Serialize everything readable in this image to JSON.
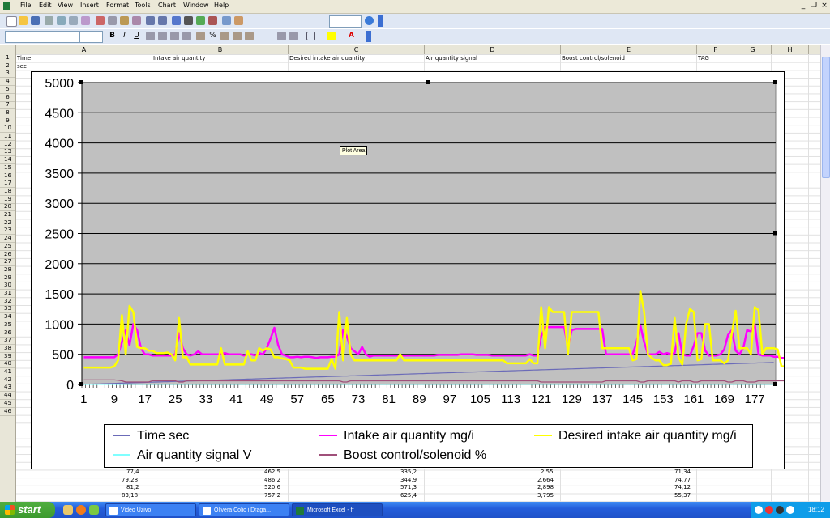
{
  "menu": {
    "items": [
      "File",
      "Edit",
      "View",
      "Insert",
      "Format",
      "Tools",
      "Chart",
      "Window",
      "Help"
    ]
  },
  "columns": [
    "A",
    "B",
    "C",
    "D",
    "E",
    "F",
    "G",
    "H"
  ],
  "rows": [
    "1",
    "2",
    "3",
    "4",
    "5",
    "6",
    "7",
    "8",
    "9",
    "10",
    "11",
    "12",
    "13",
    "14",
    "15",
    "16",
    "17",
    "18",
    "19",
    "20",
    "21",
    "22",
    "23",
    "24",
    "25",
    "26",
    "27",
    "28",
    "29",
    "30",
    "31",
    "32",
    "33",
    "34",
    "35",
    "36",
    "37",
    "38",
    "39",
    "40",
    "41",
    "42",
    "43",
    "44",
    "45",
    "46"
  ],
  "sheet": {
    "header_row": [
      "Time",
      "Intake air quantity",
      "Desired intake air quantity",
      "Air quantity signal",
      "Boost control/solenoid",
      "TAG"
    ],
    "row2_a": "sec",
    "bottom_rows": [
      [
        "77,4",
        "462,5",
        "335,2",
        "2,55",
        "71,34"
      ],
      [
        "79,28",
        "486,2",
        "344,9",
        "2,664",
        "74,77"
      ],
      [
        "81,2",
        "520,6",
        "571,3",
        "2,898",
        "74,12"
      ],
      [
        "83,18",
        "757,2",
        "625,4",
        "3,795",
        "55,37"
      ]
    ]
  },
  "chart_data": {
    "type": "line",
    "title": "",
    "xlabel": "",
    "ylabel": "",
    "ylim": [
      0,
      5000
    ],
    "yticks": [
      0,
      500,
      1000,
      1500,
      2000,
      2500,
      3000,
      3500,
      4000,
      4500,
      5000
    ],
    "x_tick_labels": [
      "1",
      "9",
      "17",
      "25",
      "33",
      "41",
      "49",
      "57",
      "65",
      "73",
      "81",
      "89",
      "97",
      "105",
      "113",
      "121",
      "129",
      "137",
      "145",
      "153",
      "161",
      "169",
      "177"
    ],
    "x_count": 182,
    "plot_background": "#c0c0c0",
    "gridlines": true,
    "legend_position": "bottom",
    "series": [
      {
        "name": "Time sec",
        "color": "#6b6bb8",
        "values": [
          2,
          4,
          6,
          8,
          10,
          12,
          14,
          16,
          18,
          20,
          22,
          24,
          26,
          28,
          30,
          32,
          34,
          36,
          38,
          40,
          42,
          44,
          46,
          48,
          50,
          52,
          54,
          56,
          58,
          60,
          62,
          64,
          66,
          68,
          70,
          72,
          74,
          76,
          78,
          80,
          82,
          84,
          86,
          88,
          90,
          92,
          94,
          96,
          98,
          100,
          102,
          104,
          106,
          108,
          110,
          112,
          114,
          116,
          118,
          120,
          122,
          124,
          126,
          128,
          130,
          132,
          134,
          136,
          138,
          140,
          142,
          144,
          146,
          148,
          150,
          152,
          154,
          156,
          158,
          160,
          162,
          164,
          166,
          168,
          170,
          172,
          174,
          176,
          178,
          180,
          182,
          184,
          186,
          188,
          190,
          192,
          194,
          196,
          198,
          200,
          202,
          204,
          206,
          208,
          210,
          212,
          214,
          216,
          218,
          220,
          222,
          224,
          226,
          228,
          230,
          232,
          234,
          236,
          238,
          240,
          242,
          244,
          246,
          248,
          250,
          252,
          254,
          256,
          258,
          260,
          262,
          264,
          266,
          268,
          270,
          272,
          274,
          276,
          278,
          280,
          282,
          284,
          286,
          288,
          290,
          292,
          294,
          296,
          298,
          300,
          302,
          304,
          306,
          308,
          310,
          312,
          314,
          316,
          318,
          320,
          322,
          324,
          326,
          328,
          330,
          332,
          334,
          336,
          338,
          340,
          342,
          344,
          346,
          348,
          350,
          352,
          354,
          356,
          358,
          360,
          362,
          364
        ]
      },
      {
        "name": "Intake air quantity mg/i",
        "color": "#ff00ff",
        "values": [
          450,
          450,
          450,
          450,
          450,
          450,
          450,
          450,
          450,
          500,
          700,
          900,
          650,
          1000,
          900,
          600,
          500,
          500,
          480,
          480,
          480,
          480,
          480,
          480,
          500,
          850,
          600,
          500,
          480,
          500,
          550,
          500,
          500,
          500,
          500,
          500,
          500,
          520,
          500,
          500,
          500,
          500,
          480,
          500,
          500,
          480,
          520,
          500,
          600,
          760,
          940,
          650,
          500,
          480,
          450,
          450,
          460,
          450,
          460,
          460,
          450,
          440,
          450,
          450,
          450,
          460,
          460,
          500,
          900,
          800,
          600,
          550,
          500,
          620,
          500,
          460,
          480,
          480,
          480,
          480,
          480,
          480,
          480,
          480,
          480,
          480,
          480,
          480,
          480,
          480,
          480,
          480,
          480,
          490,
          490,
          490,
          490,
          490,
          490,
          500,
          500,
          500,
          500,
          490,
          490,
          490,
          490,
          480,
          480,
          480,
          480,
          480,
          480,
          480,
          480,
          480,
          480,
          500,
          480,
          480,
          800,
          950,
          950,
          950,
          950,
          950,
          950,
          620,
          900,
          920,
          920,
          920,
          920,
          920,
          920,
          920,
          920,
          500,
          500,
          500,
          500,
          500,
          500,
          500,
          500,
          700,
          980,
          700,
          500,
          500,
          500,
          540,
          500,
          520,
          500,
          520,
          850,
          500,
          480,
          480,
          640,
          850,
          850,
          560,
          480,
          480,
          480,
          500,
          580,
          820,
          900,
          560,
          500,
          600,
          900,
          880,
          1000,
          500,
          480,
          480,
          480,
          460,
          460,
          440,
          440,
          440,
          440,
          430,
          430
        ]
      },
      {
        "name": "Desired intake air quantity mg/i",
        "color": "#ffff00",
        "values": [
          280,
          280,
          280,
          280,
          280,
          280,
          280,
          280,
          300,
          400,
          1150,
          500,
          1300,
          1200,
          620,
          600,
          600,
          560,
          560,
          520,
          520,
          520,
          530,
          500,
          400,
          1100,
          450,
          450,
          330,
          330,
          330,
          330,
          330,
          330,
          330,
          330,
          600,
          330,
          330,
          330,
          330,
          330,
          330,
          550,
          400,
          400,
          600,
          560,
          600,
          580,
          450,
          450,
          430,
          420,
          400,
          280,
          280,
          280,
          260,
          260,
          260,
          260,
          260,
          260,
          260,
          420,
          260,
          1200,
          400,
          1100,
          500,
          400,
          400,
          400,
          400,
          400,
          400,
          400,
          400,
          400,
          400,
          400,
          400,
          500,
          400,
          400,
          400,
          400,
          400,
          400,
          400,
          400,
          400,
          400,
          400,
          400,
          400,
          400,
          400,
          400,
          400,
          400,
          400,
          400,
          400,
          400,
          400,
          400,
          400,
          400,
          400,
          350,
          350,
          350,
          350,
          350,
          350,
          420,
          350,
          350,
          1280,
          600,
          1280,
          1200,
          1200,
          1200,
          1200,
          500,
          1200,
          1200,
          1200,
          1200,
          1200,
          1200,
          1200,
          1200,
          600,
          600,
          600,
          600,
          600,
          600,
          600,
          600,
          400,
          420,
          1550,
          1200,
          500,
          440,
          400,
          400,
          320,
          320,
          340,
          1100,
          450,
          330,
          1000,
          1250,
          1200,
          400,
          420,
          1000,
          1000,
          400,
          400,
          400,
          350,
          400,
          850,
          1220,
          600,
          600,
          600,
          500,
          1280,
          1230,
          500,
          600,
          600,
          600,
          580,
          300,
          300,
          300,
          300,
          300,
          280,
          280
        ]
      },
      {
        "name": "Air quantity signal V",
        "color": "#80ffff",
        "values": [
          2,
          2,
          2,
          2,
          2,
          2,
          2,
          2,
          2,
          2,
          2,
          3,
          3,
          3,
          3,
          3,
          3,
          3,
          3,
          3,
          3,
          3,
          3,
          3,
          3,
          3,
          3,
          3,
          3,
          3,
          3,
          3,
          3,
          3,
          3,
          3,
          3,
          3,
          3,
          3,
          3,
          3,
          3,
          3,
          3,
          3,
          3,
          3,
          3,
          3,
          3,
          3,
          3,
          3,
          3,
          3,
          3,
          3,
          3,
          3,
          3,
          3,
          3,
          3,
          3,
          3,
          3,
          3,
          3,
          3,
          3,
          3,
          3,
          3,
          3,
          3,
          3,
          3,
          3,
          3,
          3,
          3,
          3,
          3,
          3,
          3,
          3,
          3,
          3,
          3,
          3,
          3,
          3,
          3,
          3,
          3,
          3,
          3,
          3,
          3,
          3,
          3,
          3,
          3,
          3,
          3,
          3,
          3,
          3,
          3,
          3,
          3,
          3,
          3,
          3,
          3,
          3,
          3,
          3,
          3,
          3,
          3,
          3,
          3,
          3,
          3,
          3,
          3,
          3,
          3,
          3,
          3,
          3,
          3,
          3,
          3,
          3,
          3,
          3,
          3,
          3,
          3,
          3,
          3,
          3,
          3,
          3,
          3,
          3,
          3,
          3,
          3,
          3,
          3,
          3,
          3,
          3,
          3,
          3,
          3,
          3,
          3,
          3,
          3,
          3,
          3,
          3,
          3,
          3,
          3,
          3,
          3,
          3,
          3,
          3,
          3,
          3,
          3,
          3,
          3,
          3,
          3
        ]
      },
      {
        "name": "Boost control/solenoid %",
        "color": "#a0507a",
        "values": [
          75,
          75,
          75,
          75,
          75,
          75,
          75,
          75,
          75,
          70,
          60,
          40,
          40,
          40,
          40,
          40,
          40,
          40,
          60,
          60,
          60,
          60,
          60,
          60,
          60,
          40,
          40,
          60,
          60,
          60,
          60,
          60,
          60,
          60,
          60,
          60,
          60,
          60,
          60,
          60,
          60,
          60,
          60,
          60,
          60,
          60,
          60,
          60,
          60,
          60,
          60,
          60,
          60,
          60,
          60,
          60,
          60,
          60,
          60,
          60,
          60,
          60,
          60,
          60,
          60,
          60,
          60,
          60,
          40,
          40,
          60,
          60,
          60,
          60,
          60,
          60,
          60,
          60,
          60,
          60,
          60,
          60,
          60,
          60,
          60,
          60,
          60,
          60,
          60,
          60,
          60,
          60,
          60,
          60,
          60,
          60,
          60,
          60,
          60,
          60,
          60,
          60,
          60,
          60,
          60,
          60,
          60,
          60,
          60,
          60,
          60,
          60,
          60,
          60,
          60,
          60,
          60,
          60,
          60,
          60,
          40,
          40,
          40,
          40,
          40,
          40,
          40,
          40,
          40,
          40,
          40,
          40,
          40,
          40,
          40,
          40,
          40,
          60,
          60,
          60,
          60,
          60,
          60,
          60,
          60,
          60,
          40,
          40,
          60,
          60,
          60,
          60,
          60,
          60,
          60,
          60,
          40,
          60,
          60,
          60,
          40,
          40,
          60,
          60,
          60,
          60,
          60,
          60,
          60,
          40,
          40,
          60,
          60,
          60,
          40,
          40,
          40,
          60,
          60,
          60,
          60,
          60,
          60,
          60,
          60,
          60,
          60,
          60
        ]
      }
    ]
  },
  "tooltip": "Plot Area",
  "taskbar": {
    "start": "start",
    "tasks": [
      "Video Uzivo",
      "Olivera Colic i Draga...",
      "Microsoft Excel - ff"
    ],
    "clock": "18:12"
  }
}
